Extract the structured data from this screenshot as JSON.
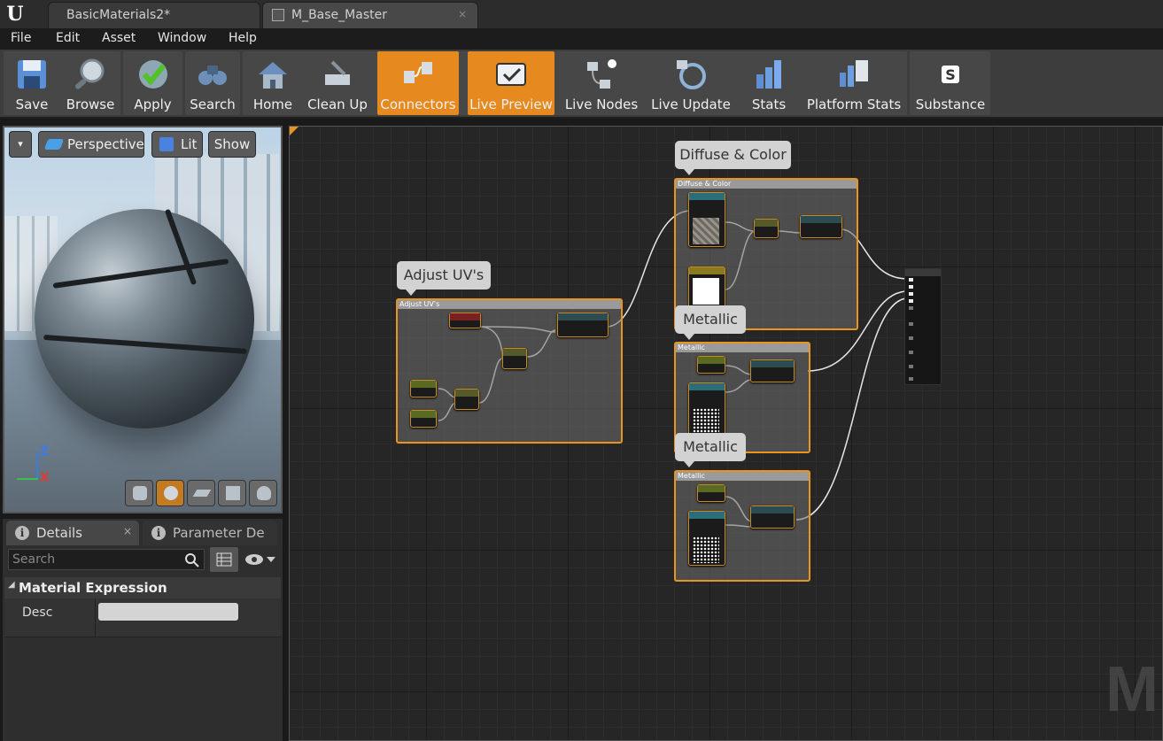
{
  "titlebar": {
    "logo": "U",
    "tabs": [
      {
        "label": "BasicMaterials2*"
      },
      {
        "label": "M_Base_Master",
        "close": "×"
      }
    ]
  },
  "menu": [
    "File",
    "Edit",
    "Asset",
    "Window",
    "Help"
  ],
  "toolbar": {
    "buttons": [
      {
        "label": "Save",
        "icon": "save-icon"
      },
      {
        "label": "Browse",
        "icon": "browse-icon"
      },
      {
        "label": "Apply",
        "icon": "apply-icon"
      },
      {
        "label": "Search",
        "icon": "search-icon"
      },
      {
        "label": "Home",
        "icon": "home-icon"
      },
      {
        "label": "Clean Up",
        "icon": "clean-up-icon"
      },
      {
        "label": "Connectors",
        "icon": "connectors-icon",
        "active": true
      },
      {
        "label": "Live Preview",
        "icon": "live-preview-icon",
        "active": true
      },
      {
        "label": "Live Nodes",
        "icon": "live-nodes-icon"
      },
      {
        "label": "Live Update",
        "icon": "live-update-icon"
      },
      {
        "label": "Stats",
        "icon": "stats-icon"
      },
      {
        "label": "Platform Stats",
        "icon": "platform-stats-icon"
      },
      {
        "label": "Substance",
        "icon": "substance-icon"
      }
    ],
    "accent": "#e68a1f"
  },
  "viewport": {
    "dropdown": "▾",
    "perspective": "Perspective",
    "lit": "Lit",
    "show": "Show",
    "axis": {
      "z": "Z",
      "x": "X"
    }
  },
  "details": {
    "tabs": [
      {
        "label": "Details",
        "close": "×"
      },
      {
        "label": "Parameter De"
      }
    ],
    "search_placeholder": "Search",
    "section": "Material Expression",
    "property_label": "Desc",
    "property_value": ""
  },
  "graph": {
    "comments": [
      {
        "bubble": "Diffuse & Color",
        "title": "Diffuse & Color"
      },
      {
        "bubble": "Adjust UV's",
        "title": "Adjust UV's"
      },
      {
        "bubble": "Metallic",
        "title": "Metallic"
      },
      {
        "bubble": "Metallic",
        "title": "Metallic"
      }
    ],
    "watermark": "M"
  }
}
